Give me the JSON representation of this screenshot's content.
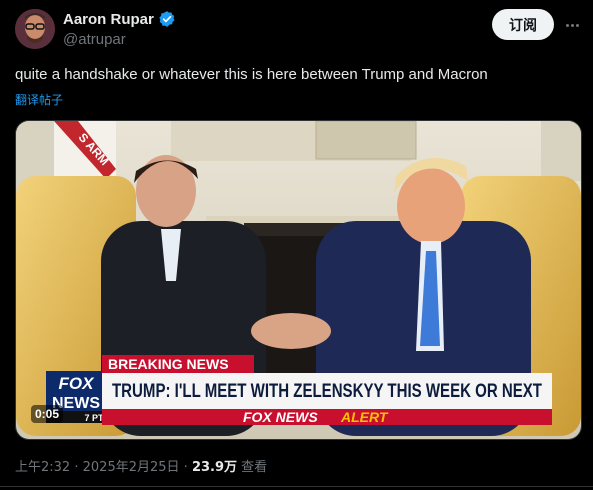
{
  "author": {
    "display_name": "Aaron Rupar",
    "handle": "@atrupar",
    "verified_color": "#1d9bf0"
  },
  "actions": {
    "subscribe_label": "订阅"
  },
  "tweet": {
    "text": "quite a handshake or whatever this is here between Trump and Macron",
    "translate_label": "翻译帖子"
  },
  "video": {
    "duration": "0:05",
    "chyron": {
      "breaking": "BREAKING NEWS",
      "headline": "TRUMP: I'LL MEET WITH ZELENSKYY THIS WEEK OR NEXT",
      "alert_brand": "FOX NEWS",
      "alert_word": "ALERT",
      "logo_top": "FOX",
      "logo_bottom": "NEWS",
      "time": "7 PT"
    },
    "flag_text": "S ARM"
  },
  "meta": {
    "time": "上午2:32",
    "separator": "·",
    "date": "2025年2月25日",
    "views_count": "23.9万",
    "views_label": "查看"
  },
  "colors": {
    "accent": "#1d9bf0",
    "background": "#000000",
    "fox_red": "#c8102e",
    "fox_blue": "#003a8c"
  },
  "icons": {
    "verified": "verified-badge-icon",
    "more": "more-icon"
  }
}
